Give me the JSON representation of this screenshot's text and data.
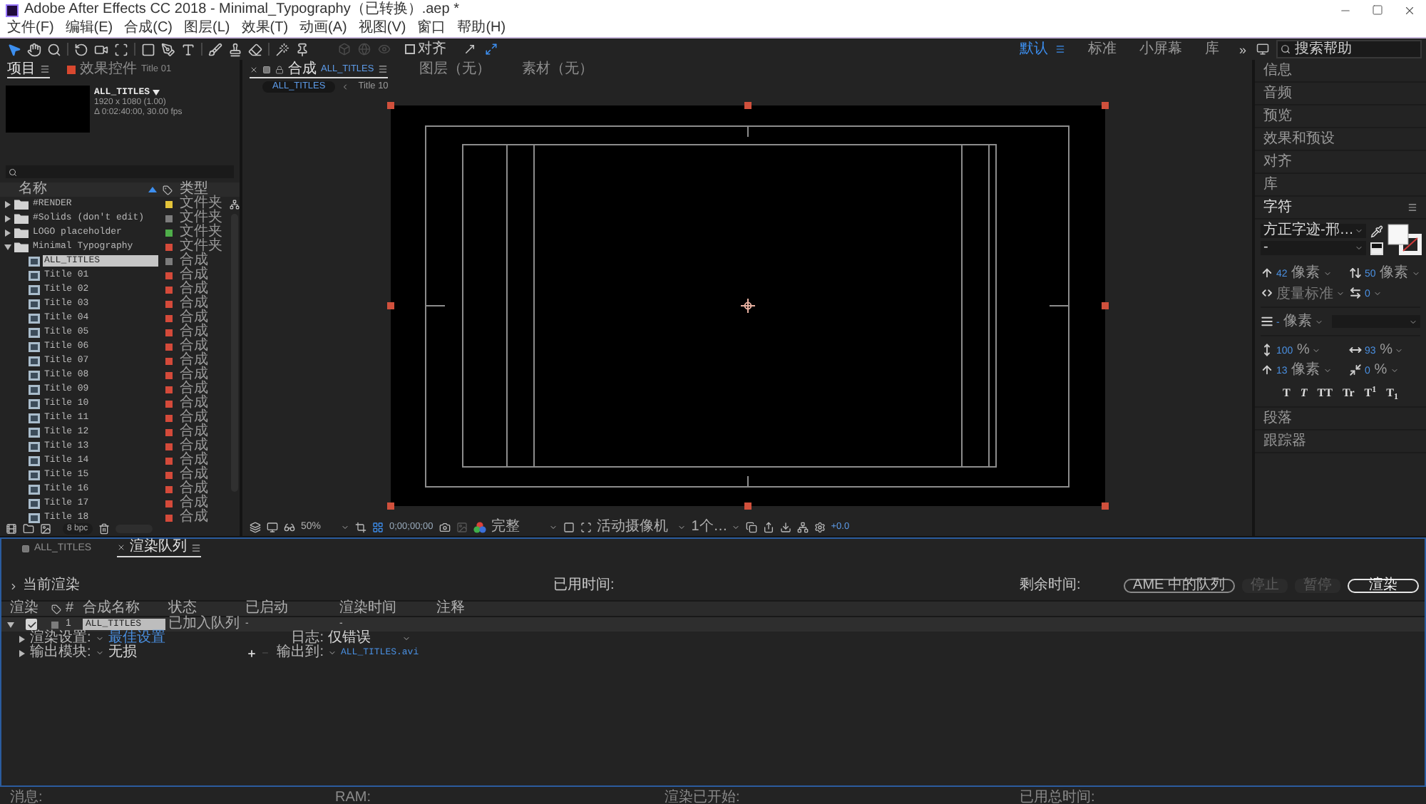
{
  "window": {
    "title": "Adobe After Effects CC 2018 - Minimal_Typography（已转换）.aep *"
  },
  "menu": [
    "文件(F)",
    "编辑(E)",
    "合成(C)",
    "图层(L)",
    "效果(T)",
    "动画(A)",
    "视图(V)",
    "窗口",
    "帮助(H)"
  ],
  "toolbar": {
    "tool_groups": [
      [
        {
          "kind": "selection",
          "selected": true
        },
        {
          "kind": "hand",
          "selected": false
        },
        {
          "kind": "zoom",
          "selected": false
        }
      ],
      [
        {
          "kind": "rotate",
          "selected": false
        },
        {
          "kind": "camera",
          "selected": false
        },
        {
          "kind": "panbehind",
          "selected": false
        }
      ],
      [
        {
          "kind": "shape",
          "selected": false
        },
        {
          "kind": "pen",
          "selected": false
        },
        {
          "kind": "type",
          "selected": false
        }
      ],
      [
        {
          "kind": "brush",
          "selected": false
        },
        {
          "kind": "stamp",
          "selected": false
        },
        {
          "kind": "eraser",
          "selected": false
        }
      ],
      [
        {
          "kind": "roto",
          "selected": false
        },
        {
          "kind": "puppet",
          "selected": false
        }
      ]
    ],
    "axis_modes": [
      {
        "kind": "local",
        "disabled": true
      },
      {
        "kind": "world",
        "disabled": true
      },
      {
        "kind": "view",
        "disabled": true
      }
    ],
    "snapping": {
      "label": "对齐",
      "checked": false
    },
    "snap_options": [
      {
        "kind": "edges",
        "on": false
      },
      {
        "kind": "features",
        "on": true
      }
    ],
    "workspaces": [
      {
        "label": "默认",
        "selected": true
      },
      {
        "label": "标准",
        "selected": false
      },
      {
        "label": "小屏幕",
        "selected": false
      },
      {
        "label": "库",
        "selected": false
      }
    ],
    "overflow": "»",
    "help_search": {
      "placeholder": "搜索帮助"
    }
  },
  "project_panel": {
    "tabs": [
      {
        "kind": "project",
        "label": "项目",
        "selected": true
      },
      {
        "kind": "effects",
        "label": "效果控件",
        "target": "Title 01",
        "selected": false
      }
    ],
    "selected_item": {
      "name": "ALL_TITLES",
      "dimensions": "1920 x 1080 (1.00)",
      "duration": "Δ 0:02:40:00, 30.00 fps"
    },
    "columns": [
      "名称",
      "类型"
    ],
    "items": [
      {
        "kind": "folder",
        "name": "#RENDER",
        "type": "文件夹",
        "color": "#e3c33a",
        "expanded": false,
        "selected": false
      },
      {
        "kind": "folder",
        "name": "#Solids (don't edit)",
        "type": "文件夹",
        "color": "#7c7c7c",
        "expanded": false,
        "selected": false
      },
      {
        "kind": "folder",
        "name": "LOGO placeholder",
        "type": "文件夹",
        "color": "#4fae4a",
        "expanded": false,
        "selected": false
      },
      {
        "kind": "folder",
        "name": "Minimal Typography",
        "type": "文件夹",
        "color": "#d44a3a",
        "expanded": true,
        "selected": false,
        "children": [
          {
            "kind": "comp",
            "name": "ALL_TITLES",
            "type": "合成",
            "color": "#7c7c7c",
            "selected": true
          },
          {
            "kind": "comp",
            "name": "Title 01",
            "type": "合成",
            "color": "#d44a3a",
            "selected": false
          },
          {
            "kind": "comp",
            "name": "Title 02",
            "type": "合成",
            "color": "#d44a3a",
            "selected": false
          },
          {
            "kind": "comp",
            "name": "Title 03",
            "type": "合成",
            "color": "#d44a3a",
            "selected": false
          },
          {
            "kind": "comp",
            "name": "Title 04",
            "type": "合成",
            "color": "#d44a3a",
            "selected": false
          },
          {
            "kind": "comp",
            "name": "Title 05",
            "type": "合成",
            "color": "#d44a3a",
            "selected": false
          },
          {
            "kind": "comp",
            "name": "Title 06",
            "type": "合成",
            "color": "#d44a3a",
            "selected": false
          },
          {
            "kind": "comp",
            "name": "Title 07",
            "type": "合成",
            "color": "#d44a3a",
            "selected": false
          },
          {
            "kind": "comp",
            "name": "Title 08",
            "type": "合成",
            "color": "#d44a3a",
            "selected": false
          },
          {
            "kind": "comp",
            "name": "Title 09",
            "type": "合成",
            "color": "#d44a3a",
            "selected": false
          },
          {
            "kind": "comp",
            "name": "Title 10",
            "type": "合成",
            "color": "#d44a3a",
            "selected": false
          },
          {
            "kind": "comp",
            "name": "Title 11",
            "type": "合成",
            "color": "#d44a3a",
            "selected": false
          },
          {
            "kind": "comp",
            "name": "Title 12",
            "type": "合成",
            "color": "#d44a3a",
            "selected": false
          },
          {
            "kind": "comp",
            "name": "Title 13",
            "type": "合成",
            "color": "#d44a3a",
            "selected": false
          },
          {
            "kind": "comp",
            "name": "Title 14",
            "type": "合成",
            "color": "#d44a3a",
            "selected": false
          },
          {
            "kind": "comp",
            "name": "Title 15",
            "type": "合成",
            "color": "#d44a3a",
            "selected": false
          },
          {
            "kind": "comp",
            "name": "Title 16",
            "type": "合成",
            "color": "#d44a3a",
            "selected": false
          },
          {
            "kind": "comp",
            "name": "Title 17",
            "type": "合成",
            "color": "#d44a3a",
            "selected": false
          },
          {
            "kind": "comp",
            "name": "Title 18",
            "type": "合成",
            "color": "#d44a3a",
            "selected": false
          }
        ]
      }
    ],
    "bit_depth": "8 bpc"
  },
  "composition_panel": {
    "tabs": [
      {
        "kind": "composition",
        "label": "合成",
        "name": "ALL_TITLES",
        "selected": true
      },
      {
        "kind": "layer",
        "label": "图层（无）",
        "selected": false
      },
      {
        "kind": "footage",
        "label": "素材（无）",
        "selected": false
      }
    ],
    "breadcrumb": [
      {
        "label": "ALL_TITLES",
        "selected": true
      },
      {
        "label": "Title 10",
        "selected": false
      }
    ],
    "viewer_controls": {
      "zoom": "50%",
      "timecode": "0;00;00;00",
      "resolution": "完整",
      "camera": "活动摄像机",
      "views": "1个…",
      "exposure": "+0.0"
    }
  },
  "side_panels": {
    "top": [
      "信息",
      "音频",
      "预览",
      "效果和预设",
      "对齐",
      "库"
    ],
    "character": {
      "title": "字符",
      "font": "方正字迹-邢…",
      "style": "-",
      "metric_rows": [
        [
          {
            "kind": "size",
            "value": "42",
            "unit": "像素"
          },
          {
            "kind": "leading",
            "value": "50",
            "unit": "像素"
          }
        ],
        [
          {
            "kind": "kerning",
            "value": "度量标准"
          },
          {
            "kind": "tracking",
            "value": "0"
          }
        ]
      ],
      "stroke": {
        "value": "-",
        "unit": "像素"
      },
      "scale_rows": [
        [
          {
            "kind": "vscale",
            "value": "100",
            "unit": "%"
          },
          {
            "kind": "hscale",
            "value": "93",
            "unit": "%"
          }
        ],
        [
          {
            "kind": "baseline",
            "value": "13",
            "unit": "像素"
          },
          {
            "kind": "tsume",
            "value": "0",
            "unit": "%"
          }
        ]
      ],
      "styles": [
        {
          "kind": "bold",
          "label": "T"
        },
        {
          "kind": "italic",
          "label": "T"
        },
        {
          "kind": "caps",
          "label": "TT"
        },
        {
          "kind": "smallcaps",
          "label": "Tr"
        },
        {
          "kind": "superscript",
          "label": "T$^{1}$"
        },
        {
          "kind": "subscript",
          "label": "T$_{1}$"
        }
      ]
    },
    "bottom": [
      "段落",
      "跟踪器"
    ]
  },
  "render_queue": {
    "tabs": [
      {
        "kind": "timeline",
        "label": "ALL_TITLES",
        "selected": false
      },
      {
        "kind": "renderqueue",
        "label": "渲染队列",
        "selected": true
      }
    ],
    "current_render": {
      "label": "当前渲染",
      "expanded": false,
      "elapsed_label": "已用时间:",
      "remaining_label": "剩余时间:"
    },
    "buttons": [
      {
        "kind": "secondary",
        "label": "AME 中的队列",
        "disabled": false
      },
      {
        "kind": "secondary",
        "label": "停止",
        "disabled": true
      },
      {
        "kind": "secondary",
        "label": "暂停",
        "disabled": true
      },
      {
        "kind": "primary",
        "label": "渲染",
        "disabled": false
      }
    ],
    "columns": [
      "渲染",
      "#",
      "合成名称",
      "状态",
      "已启动",
      "渲染时间",
      "注释"
    ],
    "items": [
      {
        "checked": true,
        "number": "1",
        "name": "ALL_TITLES",
        "status": "已加入队列",
        "started": "-",
        "render_time": "-",
        "expanded": true,
        "settings": [
          {
            "kind": "render",
            "label": "渲染设置:",
            "value": "最佳设置",
            "expanded": false,
            "side_label": "日志:",
            "side_value": "仅错误"
          },
          {
            "kind": "output",
            "label": "输出模块:",
            "value": "无损",
            "expanded": false,
            "side_label": "输出到:",
            "side_value": "ALL_TITLES.avi"
          }
        ]
      }
    ]
  },
  "status_bar": [
    "消息:",
    "RAM:",
    "渲染已开始:",
    "已用总时间:"
  ]
}
